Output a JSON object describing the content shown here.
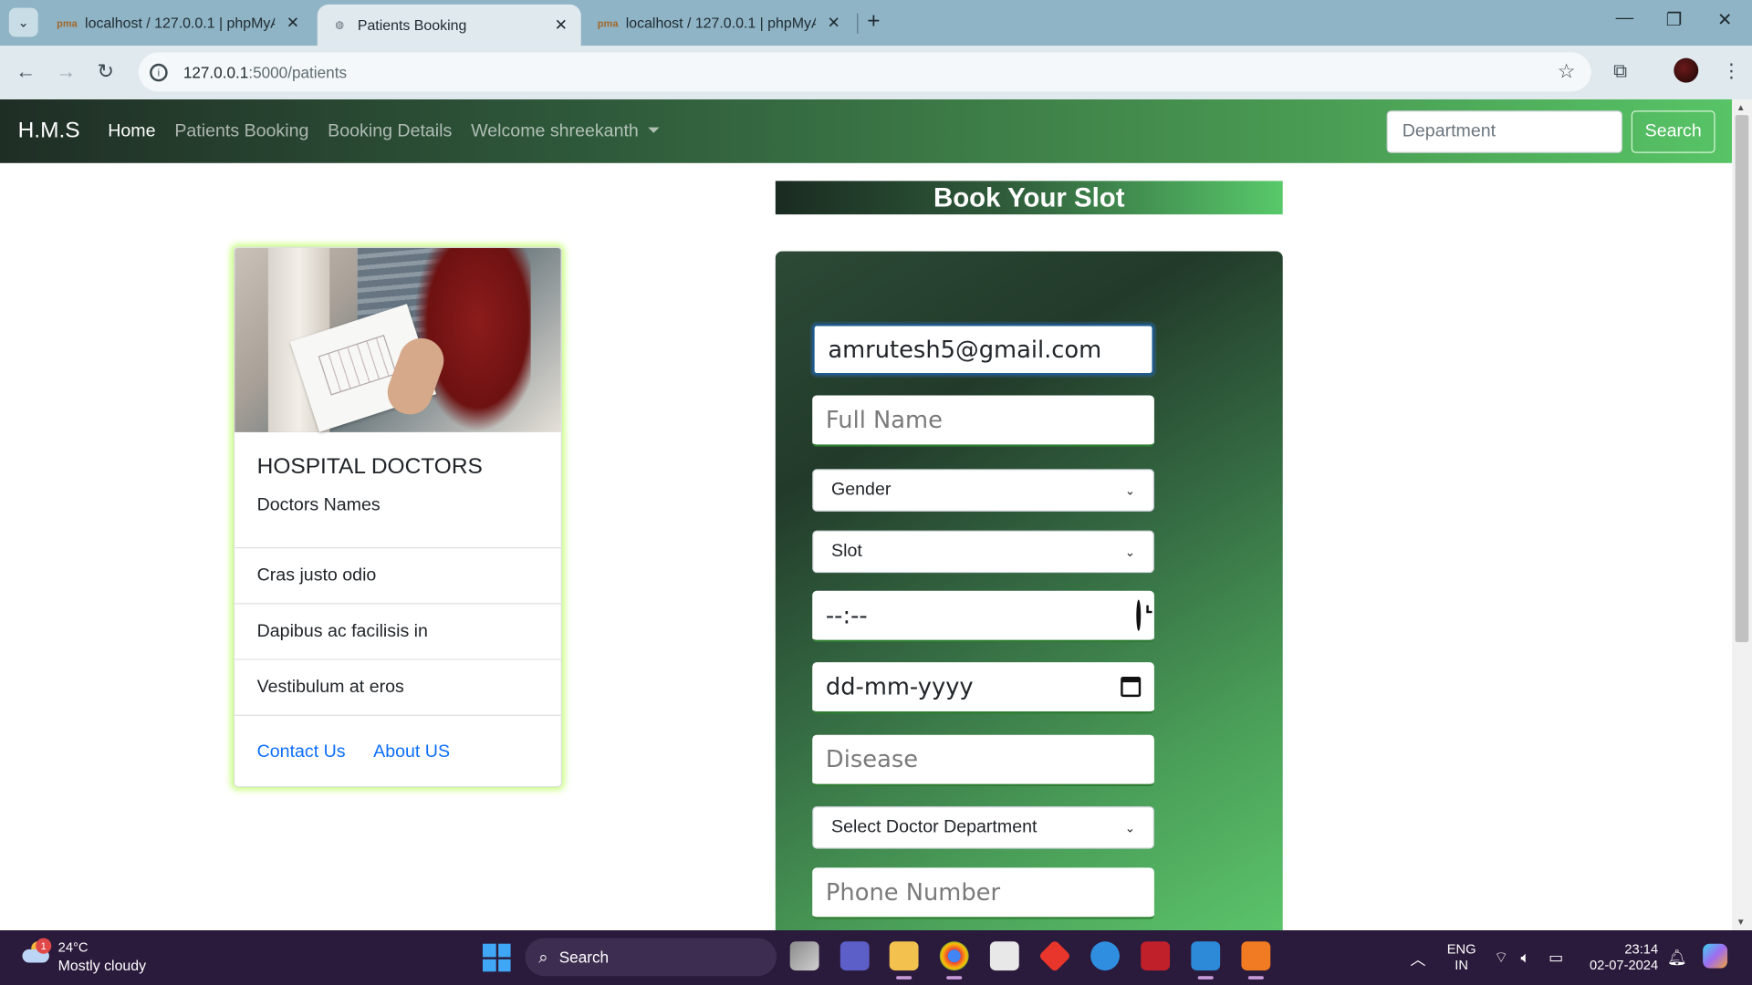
{
  "browser": {
    "tabs": [
      {
        "title": "localhost / 127.0.0.1 | phpMyAdmin",
        "active": false
      },
      {
        "title": "Patients Booking",
        "active": true
      },
      {
        "title": "localhost / 127.0.0.1 | phpMyAdmin",
        "active": false
      }
    ],
    "url_host": "127.0.0.1",
    "url_path": ":5000/patients"
  },
  "navbar": {
    "brand": "H.M.S",
    "links": [
      "Home",
      "Patients Booking",
      "Booking Details",
      "Welcome shreekanth"
    ],
    "search_placeholder": "Department",
    "search_button": "Search",
    "accent_colors": [
      "#1f2e25",
      "#57c466"
    ]
  },
  "card": {
    "title": "HOSPITAL DOCTORS",
    "subtitle": "Doctors Names",
    "items": [
      "Cras justo odio",
      "Dapibus ac facilisis in",
      "Vestibulum at eros"
    ],
    "links": [
      "Contact Us",
      "About US"
    ]
  },
  "booking": {
    "heading": "Book Your Slot",
    "email_value": "amrutesh5@gmail.com",
    "fullname_placeholder": "Full Name",
    "gender_selected": "Gender",
    "slot_selected": "Slot",
    "time_placeholder": "--:--",
    "date_placeholder": "dd-mm-yyyy",
    "disease_placeholder": "Disease",
    "department_selected": "Select Doctor Department",
    "phone_placeholder": "Phone Number"
  },
  "taskbar": {
    "weather_temp": "24°C",
    "weather_desc": "Mostly cloudy",
    "weather_badge": "1",
    "search_label": "Search",
    "lang_top": "ENG",
    "lang_bottom": "IN",
    "time": "23:14",
    "date": "02-07-2024"
  }
}
